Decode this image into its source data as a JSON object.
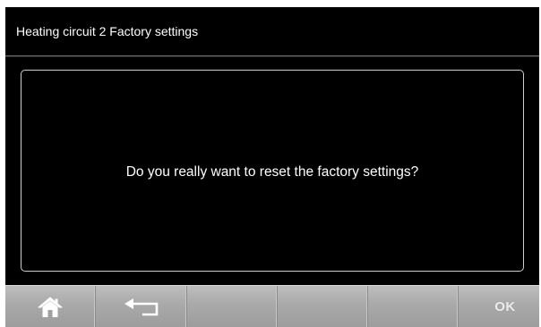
{
  "header": {
    "title": "Heating circuit 2 Factory settings"
  },
  "dialog": {
    "message": "Do you really want to reset the factory settings?"
  },
  "toolbar": {
    "buttons": [
      {
        "icon": "home-icon",
        "label": ""
      },
      {
        "icon": "back-arrow-icon",
        "label": ""
      },
      {
        "icon": "",
        "label": ""
      },
      {
        "icon": "",
        "label": ""
      },
      {
        "icon": "",
        "label": ""
      },
      {
        "icon": "",
        "label": "OK"
      }
    ],
    "ok_label": "OK"
  },
  "colors": {
    "background": "#000000",
    "text": "#ffffff",
    "dialog_border": "#cfcfcf",
    "toolbar": "#a9a9a9"
  }
}
